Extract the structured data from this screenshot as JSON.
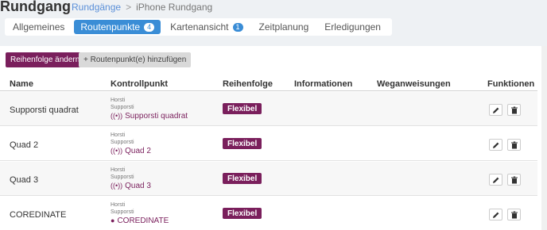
{
  "header": {
    "title": "Rundgang",
    "breadcrumb": {
      "link": "Rundgänge",
      "separator": ">",
      "current": "iPhone Rundgang"
    }
  },
  "tabs": [
    {
      "label": "Allgemeines",
      "badge": null
    },
    {
      "label": "Routenpunkte",
      "badge": "4",
      "active": true
    },
    {
      "label": "Kartenansicht",
      "badge": "1"
    },
    {
      "label": "Zeitplanung",
      "badge": null
    },
    {
      "label": "Erledigungen",
      "badge": null
    }
  ],
  "toolbar": {
    "reorder_label": "Reihenfolge ändern",
    "add_label": "+ Routenpunkt(e) hinzufügen"
  },
  "table": {
    "columns": [
      "Name",
      "Kontrollpunkt",
      "Reihenfolge",
      "Informationen",
      "Weganweisungen",
      "Funktionen"
    ],
    "rows": [
      {
        "name": "Supporsti quadrat",
        "cp_line1": "Horsti",
        "cp_line2": "Supporsti",
        "cp_name": "Supporsti quadrat",
        "cp_icon": "beacon-icon",
        "order": "Flexibel"
      },
      {
        "name": "Quad 2",
        "cp_line1": "Horsti",
        "cp_line2": "Supporsti",
        "cp_name": "Quad 2",
        "cp_icon": "beacon-icon",
        "order": "Flexibel"
      },
      {
        "name": "Quad 3",
        "cp_line1": "Horsti",
        "cp_line2": "Supporsti",
        "cp_name": "Quad 3",
        "cp_icon": "beacon-icon",
        "order": "Flexibel"
      },
      {
        "name": "COREDINATE",
        "cp_line1": "Horsti",
        "cp_line2": "Supporsti",
        "cp_name": "COREDINATE",
        "cp_icon": "map-marker-icon",
        "order": "Flexibel"
      }
    ]
  },
  "colors": {
    "accent": "#7a1f5c",
    "tab_active": "#3a8dd6",
    "background": "#eef1f4"
  }
}
